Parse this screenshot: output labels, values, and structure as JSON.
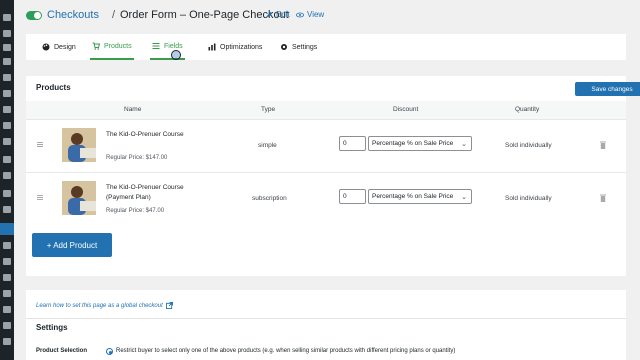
{
  "header": {
    "breadcrumb_link": "Checkouts",
    "separator": "/",
    "title": "Order Form – One-Page Checkout",
    "edit_label": "Edit",
    "view_label": "View",
    "toggle_on": true
  },
  "tabs": [
    {
      "label": "Design",
      "icon": "palette-icon"
    },
    {
      "label": "Products",
      "icon": "cart-icon",
      "active": true
    },
    {
      "label": "Fields",
      "icon": "list-icon"
    },
    {
      "label": "Optimizations",
      "icon": "chart-icon"
    },
    {
      "label": "Settings",
      "icon": "gear-icon"
    }
  ],
  "products": {
    "title": "Products",
    "save_label": "Save changes",
    "columns": {
      "name": "Name",
      "type": "Type",
      "discount": "Discount",
      "quantity": "Quantity"
    },
    "rows": [
      {
        "name": "The Kid-O-Prenuer Course",
        "price": "Regular Price: $147.00",
        "type": "simple",
        "discount_value": "0",
        "discount_type": "Percentage % on Sale Price",
        "quantity": "Sold individually"
      },
      {
        "name": "The Kid-O-Prenuer Course (Payment Plan)",
        "price": "Regular Price: $47.00",
        "type": "subscription",
        "discount_value": "0",
        "discount_type": "Percentage % on Sale Price",
        "quantity": "Sold individually"
      }
    ],
    "add_label": "+ Add Product"
  },
  "settings": {
    "learn_link": "Learn how to set this page as a global checkout",
    "title": "Settings",
    "product_selection_label": "Product Selection",
    "product_selection_option": "Restrict buyer to select only one of the above products (e.g. when selling similar products with different pricing plans or quantity)"
  },
  "colors": {
    "accent": "#2271b1",
    "active_tab": "#3a9b4c",
    "sidebar": "#1d2327"
  }
}
